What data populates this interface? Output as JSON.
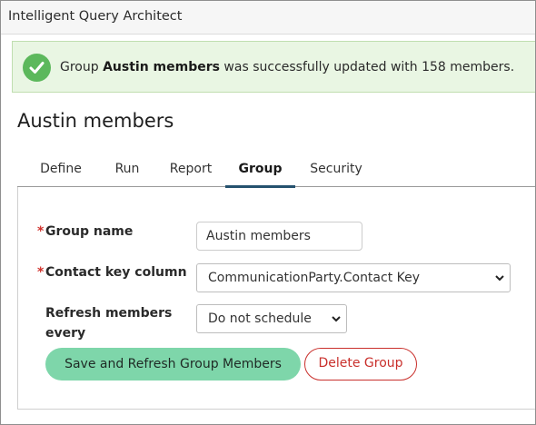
{
  "app": {
    "title": "Intelligent Query Architect"
  },
  "alert": {
    "prefix": "Group ",
    "group_name": "Austin members",
    "suffix": " was successfully updated with 158 members.",
    "icon": "checkmark-circle-icon",
    "color": "#5cb85c"
  },
  "page": {
    "title": "Austin members"
  },
  "tabs": [
    {
      "label": "Define",
      "active": false
    },
    {
      "label": "Run",
      "active": false
    },
    {
      "label": "Report",
      "active": false
    },
    {
      "label": "Group",
      "active": true
    },
    {
      "label": "Security",
      "active": false
    }
  ],
  "form": {
    "group_name": {
      "label": "Group name",
      "required": "*",
      "value": "Austin members"
    },
    "contact_key": {
      "label": "Contact key column",
      "required": "*",
      "value": "CommunicationParty.Contact Key"
    },
    "refresh": {
      "label_line1": "Refresh members",
      "label_line2": "every",
      "value": "Do not schedule"
    }
  },
  "buttons": {
    "save_label": "Save and Refresh Group Members",
    "delete_label": "Delete Group"
  },
  "colors": {
    "accent": "#25516e",
    "save": "#7ed6aa",
    "danger": "#c9302c"
  }
}
